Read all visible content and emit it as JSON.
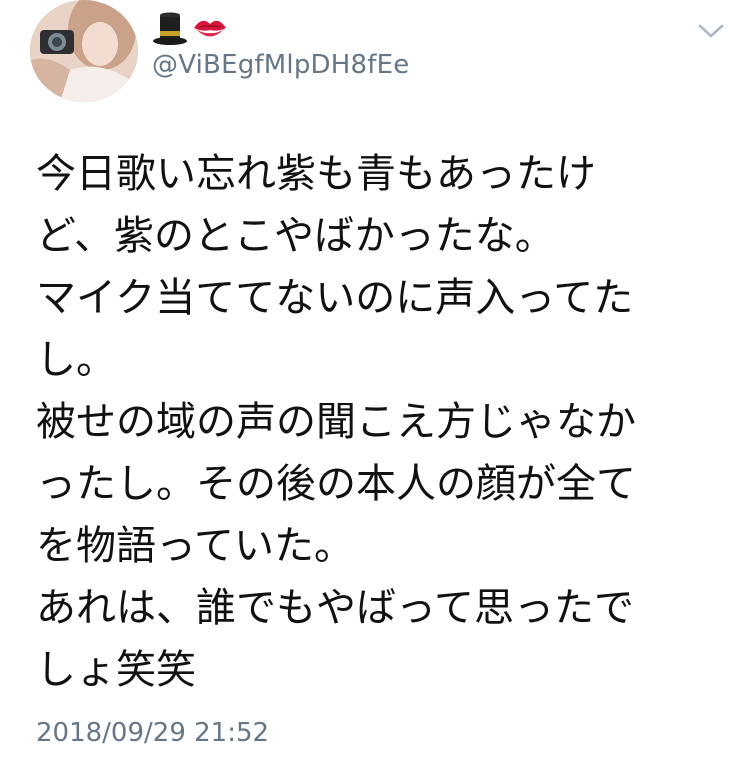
{
  "tweet": {
    "display_name_emoji": [
      "top-hat-emoji",
      "kiss-mark-emoji"
    ],
    "handle": "@ViBEgfMlpDH8fEe",
    "text_lines": [
      "今日歌い忘れ紫も青もあったけ",
      "ど、紫のとこやばかったな。",
      "マイク当ててないのに声入ってた",
      "し。",
      "被せの域の声の聞こえ方じゃなか",
      "ったし。その後の本人の顔が全て",
      "を物語っていた。",
      "あれは、誰でもやばって思ったで",
      "しょ笑笑"
    ],
    "timestamp": "2018/09/29 21:52"
  },
  "icons": {
    "avatar": "profile-photo",
    "menu": "chevron-down-icon"
  },
  "colors": {
    "text": "#111111",
    "secondary_text": "#657786",
    "background": "#ffffff",
    "chevron": "#aab8c2"
  }
}
